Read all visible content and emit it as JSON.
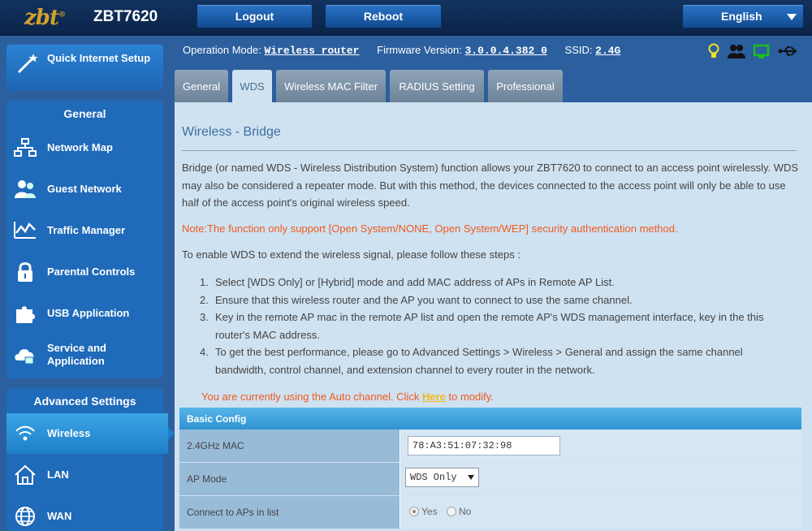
{
  "header": {
    "logo_text": "zbt",
    "model": "ZBT7620",
    "logout_label": "Logout",
    "reboot_label": "Reboot",
    "language": "English"
  },
  "sidebar": {
    "quick_setup": "Quick Internet Setup",
    "general_heading": "General",
    "general_items": [
      {
        "label": "Network Map",
        "icon": "network-map-icon"
      },
      {
        "label": "Guest Network",
        "icon": "guest-network-icon"
      },
      {
        "label": "Traffic Manager",
        "icon": "traffic-manager-icon"
      },
      {
        "label": "Parental Controls",
        "icon": "lock-icon"
      },
      {
        "label": "USB Application",
        "icon": "puzzle-icon"
      },
      {
        "label": "Service and Application",
        "icon": "cloud-icon"
      }
    ],
    "advanced_heading": "Advanced Settings",
    "advanced_items": [
      {
        "label": "Wireless",
        "icon": "wifi-icon",
        "active": true
      },
      {
        "label": "LAN",
        "icon": "home-icon"
      },
      {
        "label": "WAN",
        "icon": "globe-icon"
      }
    ]
  },
  "infobar": {
    "op_mode_label": "Operation Mode:",
    "op_mode_value": "Wireless router",
    "fw_label": "Firmware Version:",
    "fw_value": "3.0.0.4.382_0",
    "ssid_label": "SSID:",
    "ssid_value": "2.4G"
  },
  "tabs": [
    "General",
    "WDS",
    "Wireless MAC Filter",
    "RADIUS Setting",
    "Professional"
  ],
  "active_tab": "WDS",
  "content": {
    "title": "Wireless - Bridge",
    "description": "Bridge (or named WDS - Wireless Distribution System) function allows your ZBT7620 to connect to an access point wirelessly. WDS may also be considered a repeater mode. But with this method, the devices connected to the access point will only be able to use half of the access point's original wireless speed.",
    "note": "Note:The function only support [Open System/NONE, Open System/WEP] security authentication method.",
    "steps_intro": "To enable WDS to extend the wireless signal, please follow these steps :",
    "steps": [
      "Select [WDS Only] or [Hybrid] mode and add MAC address of APs in Remote AP List.",
      "Ensure that this wireless router and the AP you want to connect to use the same channel.",
      "Key in the remote AP mac in the remote AP list and open the remote AP's WDS management interface, key in the this router's MAC address.",
      "To get the best performance, please go to Advanced Settings > Wireless > General and assign the same channel bandwidth, control channel, and extension channel to every router in the network."
    ],
    "channel_prefix": "You are currently using the Auto channel. Click ",
    "channel_link": "Here",
    "channel_suffix": " to modify."
  },
  "config": {
    "heading": "Basic Config",
    "mac_label": "2.4GHz MAC",
    "mac_value": "78:A3:51:07:32:98",
    "ap_mode_label": "AP Mode",
    "ap_mode_value": "WDS Only",
    "connect_label": "Connect to APs in list",
    "yes_label": "Yes",
    "no_label": "No",
    "connect_selected": "Yes"
  },
  "colors": {
    "accent": "#1f6ab9",
    "active_nav": "#3ba5e5",
    "note": "#f05a1e",
    "link": "#f3b81b"
  }
}
